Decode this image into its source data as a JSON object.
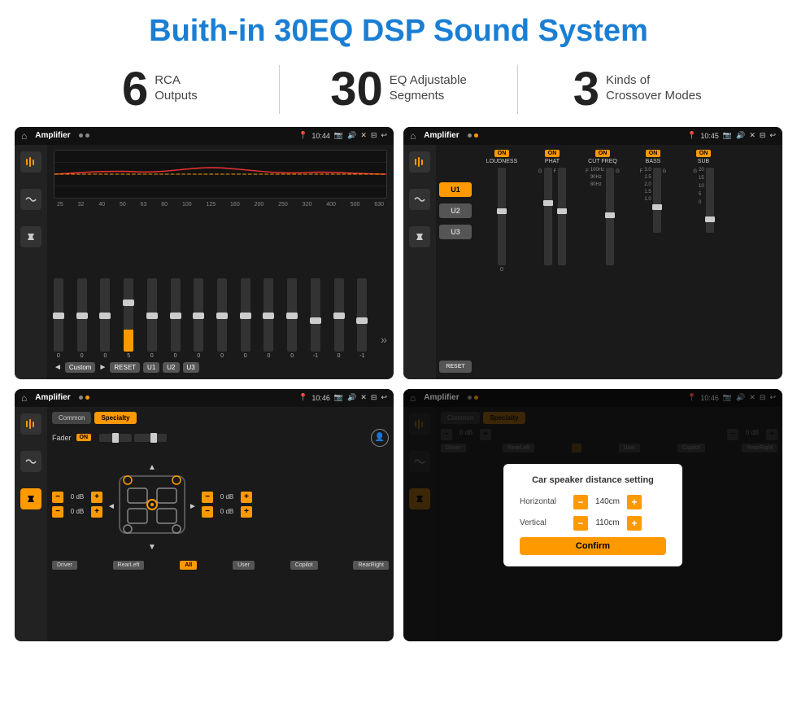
{
  "header": {
    "title": "Buith-in 30EQ DSP Sound System"
  },
  "stats": [
    {
      "number": "6",
      "text": "RCA\nOutputs"
    },
    {
      "number": "30",
      "text": "EQ Adjustable\nSegments"
    },
    {
      "number": "3",
      "text": "Kinds of\nCrossover Modes"
    }
  ],
  "screens": [
    {
      "id": "eq-screen",
      "status_title": "Amplifier",
      "time": "10:44",
      "type": "equalizer"
    },
    {
      "id": "crossover-screen",
      "status_title": "Amplifier",
      "time": "10:45",
      "type": "crossover"
    },
    {
      "id": "fader-screen",
      "status_title": "Amplifier",
      "time": "10:46",
      "type": "fader"
    },
    {
      "id": "distance-screen",
      "status_title": "Amplifier",
      "time": "10:46",
      "type": "distance"
    }
  ],
  "eq": {
    "frequencies": [
      "25",
      "32",
      "40",
      "50",
      "63",
      "80",
      "100",
      "125",
      "160",
      "200",
      "250",
      "320",
      "400",
      "500",
      "630"
    ],
    "values": [
      "0",
      "0",
      "0",
      "5",
      "0",
      "0",
      "0",
      "0",
      "0",
      "0",
      "0",
      "-1",
      "0",
      "-1"
    ],
    "presets": [
      "Custom",
      "RESET",
      "U1",
      "U2",
      "U3"
    ]
  },
  "crossover": {
    "presets": [
      "U1",
      "U2",
      "U3"
    ],
    "channels": [
      {
        "label": "LOUDNESS",
        "on": true
      },
      {
        "label": "PHAT",
        "on": true
      },
      {
        "label": "CUT FREQ",
        "on": true
      },
      {
        "label": "BASS",
        "on": true
      },
      {
        "label": "SUB",
        "on": true
      }
    ]
  },
  "fader": {
    "tabs": [
      "Common",
      "Specialty"
    ],
    "fader_label": "Fader",
    "on": "ON",
    "volume_rows": [
      {
        "value": "0 dB"
      },
      {
        "value": "0 dB"
      },
      {
        "value": "0 dB"
      },
      {
        "value": "0 dB"
      }
    ],
    "bottom_buttons": [
      "Driver",
      "RearLeft",
      "All",
      "User",
      "Copilot",
      "RearRight"
    ]
  },
  "dialog": {
    "title": "Car speaker distance setting",
    "rows": [
      {
        "label": "Horizontal",
        "value": "140cm"
      },
      {
        "label": "Vertical",
        "value": "110cm"
      }
    ],
    "confirm": "Confirm"
  }
}
